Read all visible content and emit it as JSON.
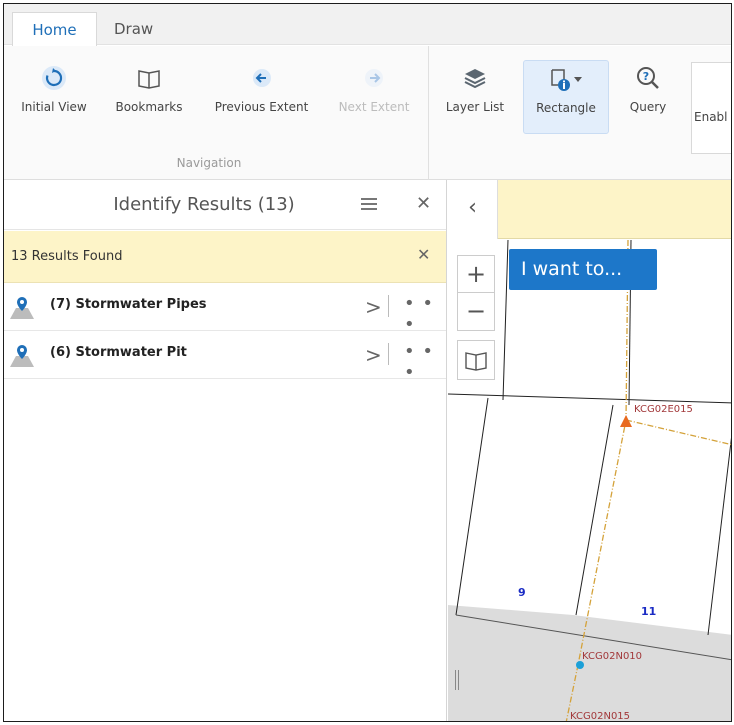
{
  "tabs": [
    {
      "label": "Home"
    },
    {
      "label": "Draw"
    }
  ],
  "ribbon": {
    "navigation": {
      "group_label": "Navigation",
      "initial_view": "Initial View",
      "bookmarks": "Bookmarks",
      "previous_extent": "Previous Extent",
      "next_extent": "Next Extent"
    },
    "layer_list": "Layer List",
    "rectangle": "Rectangle",
    "query": "Query",
    "enable": "Enabl"
  },
  "panel": {
    "title": "Identify Results (13)",
    "results_found": "13 Results Found",
    "results": [
      {
        "label": "(7) Stormwater Pipes"
      },
      {
        "label": "(6) Stormwater Pit"
      }
    ]
  },
  "map": {
    "i_want_to": "I want to...",
    "labels": {
      "kcg02e015": "KCG02E015",
      "kcg02n010": "KCG02N010",
      "kcg02n015": "KCG02N015",
      "lot9": "9",
      "lot11": "11"
    }
  },
  "colors": {
    "accent": "#1f6fb8",
    "button_blue": "#1d77c9",
    "results_bar": "#fdf4c8",
    "pipe": "#d4a23a",
    "pit_marker": "#e86a1f",
    "node_marker": "#1ca0d8",
    "label_red": "#a2383a",
    "lot_number": "#1a2bc4"
  }
}
